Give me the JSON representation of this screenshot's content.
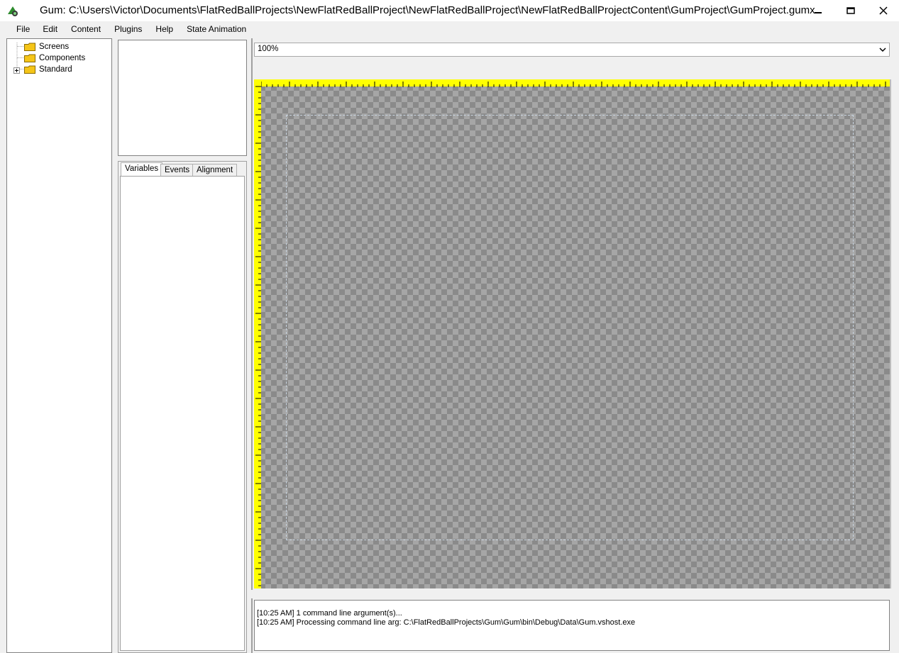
{
  "window": {
    "title": "Gum: C:\\Users\\Victor\\Documents\\FlatRedBallProjects\\NewFlatRedBallProject\\NewFlatRedBallProject\\NewFlatRedBallProjectContent\\GumProject\\GumProject.gumx",
    "icon": "gum-app-icon",
    "controls": [
      "minimize",
      "maximize",
      "close"
    ]
  },
  "menu": {
    "items": [
      "File",
      "Edit",
      "Content",
      "Plugins",
      "Help",
      "State Animation"
    ]
  },
  "tree": {
    "items": [
      {
        "label": "Screens",
        "expandable": false
      },
      {
        "label": "Components",
        "expandable": false
      },
      {
        "label": "Standard",
        "expandable": true
      }
    ]
  },
  "properties": {
    "tabs": [
      "Variables",
      "Events",
      "Alignment"
    ],
    "active_tab": "Variables"
  },
  "zoom": {
    "value": "100%"
  },
  "output": {
    "lines": [
      "[10:25 AM] 1 command line argument(s)...",
      "[10:25 AM] Processing command line arg: C:\\FlatRedBallProjects\\Gum\\Gum\\bin\\Debug\\Data\\Gum.vshost.exe"
    ]
  },
  "colors": {
    "ruler": "#ffff00",
    "checker_dark": "#8a8a8a",
    "checker_light": "#a6a6a6",
    "panel_bg": "#f0f0f0"
  }
}
